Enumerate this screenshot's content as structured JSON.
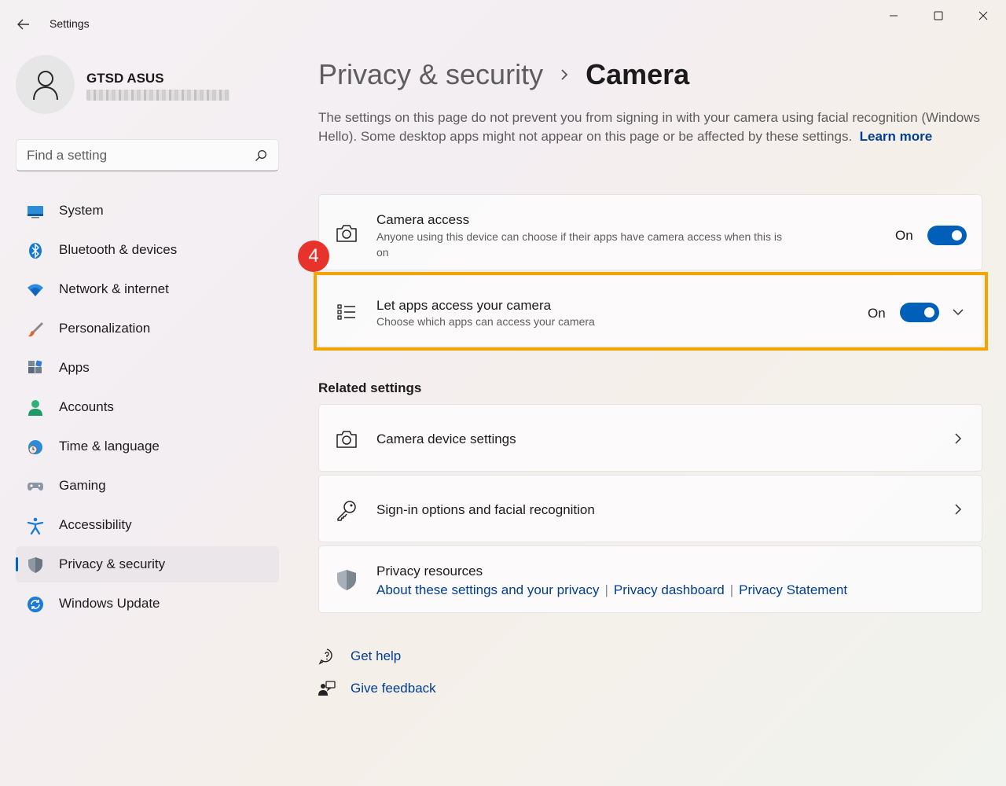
{
  "window": {
    "title": "Settings"
  },
  "user": {
    "name": "GTSD ASUS"
  },
  "search": {
    "placeholder": "Find a setting"
  },
  "sidebar": {
    "items": [
      {
        "label": "System",
        "icon": "system-icon"
      },
      {
        "label": "Bluetooth & devices",
        "icon": "bluetooth-icon"
      },
      {
        "label": "Network & internet",
        "icon": "wifi-icon"
      },
      {
        "label": "Personalization",
        "icon": "brush-icon"
      },
      {
        "label": "Apps",
        "icon": "apps-icon"
      },
      {
        "label": "Accounts",
        "icon": "account-icon"
      },
      {
        "label": "Time & language",
        "icon": "globe-clock-icon"
      },
      {
        "label": "Gaming",
        "icon": "gamepad-icon"
      },
      {
        "label": "Accessibility",
        "icon": "accessibility-icon"
      },
      {
        "label": "Privacy & security",
        "icon": "shield-icon",
        "active": true
      },
      {
        "label": "Windows Update",
        "icon": "update-icon"
      }
    ]
  },
  "breadcrumb": {
    "parent": "Privacy & security",
    "current": "Camera"
  },
  "description": {
    "text": "The settings on this page do not prevent you from signing in with your camera using facial recognition (Windows Hello). Some desktop apps might not appear on this page or be affected by these settings.",
    "link": "Learn more"
  },
  "camera_access": {
    "title": "Camera access",
    "subtitle": "Anyone using this device can choose if their apps have camera access when this is on",
    "state": "On"
  },
  "apps_access": {
    "title": "Let apps access your camera",
    "subtitle": "Choose which apps can access your camera",
    "state": "On"
  },
  "annotation": {
    "step": "4",
    "highlight_color": "#f0a500",
    "badge_color": "#e8332c"
  },
  "related": {
    "title": "Related settings",
    "camera_device": "Camera device settings",
    "signin": "Sign-in options and facial recognition",
    "privacy_resources": {
      "title": "Privacy resources",
      "links": [
        "About these settings and your privacy",
        "Privacy dashboard",
        "Privacy Statement"
      ]
    }
  },
  "help": {
    "get_help": "Get help",
    "give_feedback": "Give feedback"
  },
  "colors": {
    "accent": "#005fb8",
    "link": "#003e92"
  }
}
